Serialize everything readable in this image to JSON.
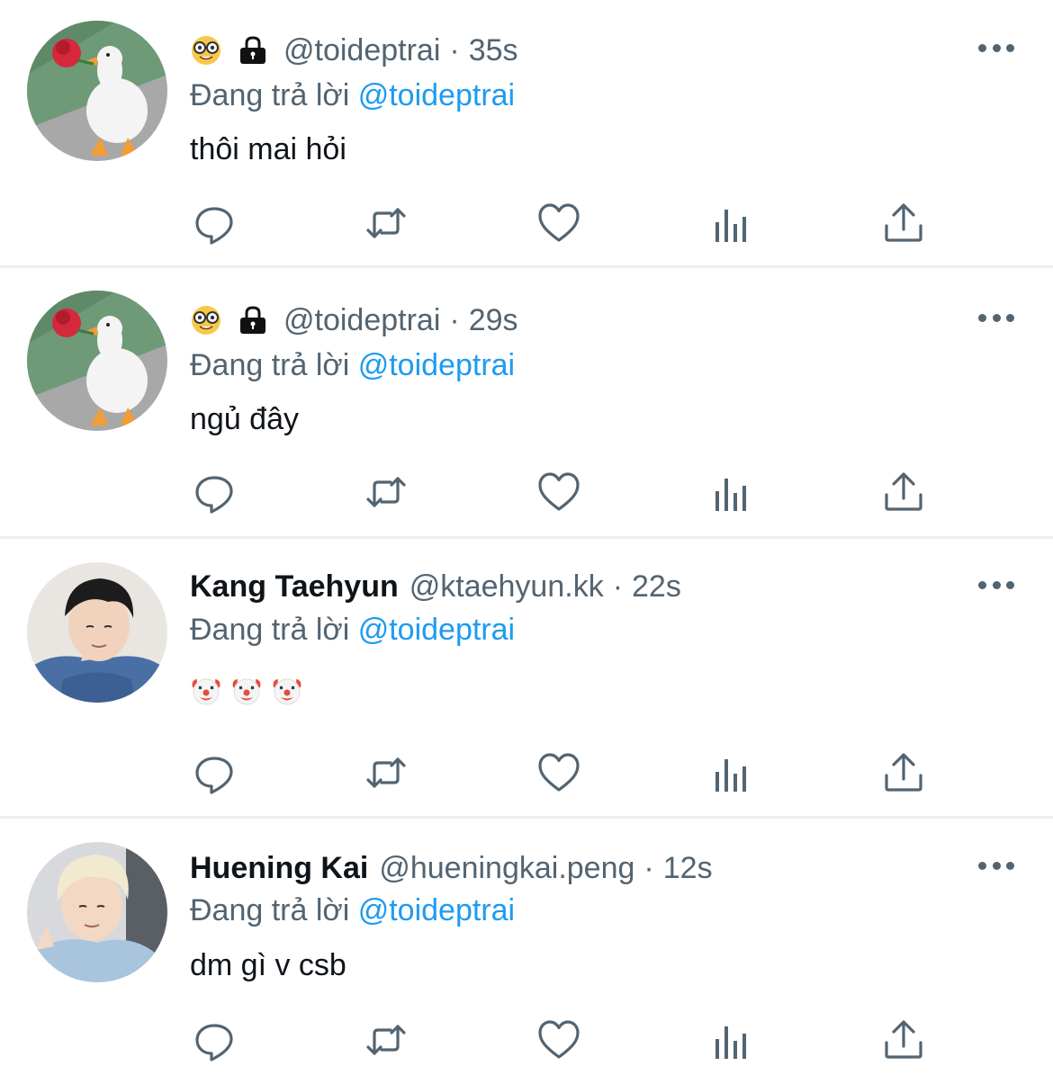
{
  "tweets": [
    {
      "name": "",
      "handle": "@toideptrai",
      "time": "35s",
      "replying_prefix": "Đang trả lời",
      "replying_to": "@toideptrai",
      "text": "thôi mai hỏi",
      "avatar": "duck-with-rose",
      "name_icons": [
        "nerd-face-icon",
        "lock-icon"
      ]
    },
    {
      "name": "",
      "handle": "@toideptrai",
      "time": "29s",
      "replying_prefix": "Đang trả lời",
      "replying_to": "@toideptrai",
      "text": "ngủ đây",
      "avatar": "duck-with-rose",
      "name_icons": [
        "nerd-face-icon",
        "lock-icon"
      ]
    },
    {
      "name": "Kang Taehyun",
      "handle": "@ktaehyun.kk",
      "time": "22s",
      "replying_prefix": "Đang trả lời",
      "replying_to": "@toideptrai",
      "text": "",
      "text_icons": [
        "clown-face-icon",
        "clown-face-icon",
        "clown-face-icon"
      ],
      "avatar": "dark-haired-person"
    },
    {
      "name": "Huening Kai",
      "handle": "@hueningkai.peng",
      "time": "12s",
      "replying_prefix": "Đang trả lời",
      "replying_to": "@toideptrai",
      "text": "dm gì v csb",
      "avatar": "blond-haired-person"
    }
  ],
  "time_separator": "·",
  "action_icons": [
    "reply-icon",
    "retweet-icon",
    "like-icon",
    "views-icon",
    "share-icon"
  ],
  "colors": {
    "link": "#1d9bf0",
    "secondary_text": "#536471",
    "primary_text": "#0f1419",
    "divider": "#eceef0"
  }
}
